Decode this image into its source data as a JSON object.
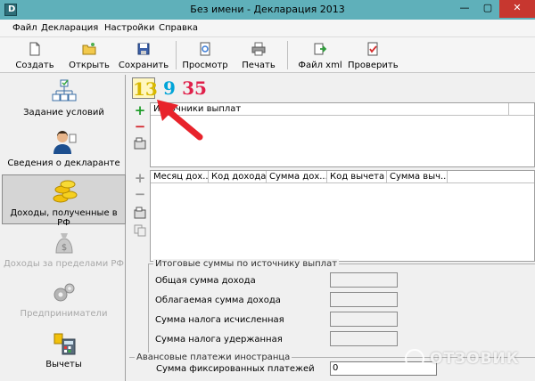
{
  "window": {
    "title": "Без имени - Декларация 2013",
    "min": "—",
    "max": "▢",
    "close": "✕"
  },
  "menu": [
    "Файл",
    "Декларация",
    "Настройки",
    "Справка"
  ],
  "toolbar": {
    "create": "Создать",
    "open": "Открыть",
    "save": "Сохранить",
    "preview": "Просмотр",
    "print": "Печать",
    "xml": "Файл xml",
    "check": "Проверить"
  },
  "sidebar": [
    {
      "label": "Задание условий",
      "icon": "tree-diagram-icon"
    },
    {
      "label": "Сведения о декларанте",
      "icon": "person-icon"
    },
    {
      "label": "Доходы, полученные в РФ",
      "icon": "coins-icon",
      "active": true
    },
    {
      "label": "Доходы за пределами РФ",
      "icon": "money-bag-icon",
      "dim": true
    },
    {
      "label": "Предприниматели",
      "icon": "gears-icon",
      "dim": true
    },
    {
      "label": "Вычеты",
      "icon": "calculator-icon"
    }
  ],
  "tax_tabs": [
    "13",
    "9",
    "35"
  ],
  "sources_grid": {
    "header": "Источники выплат"
  },
  "income_grid": {
    "headers": [
      "Месяц дох...",
      "Код дохода",
      "Сумма дох...",
      "Код вычета",
      "Сумма выч..."
    ]
  },
  "totals": {
    "title": "Итоговые суммы по источнику выплат",
    "rows": [
      "Общая сумма дохода",
      "Облагаемая сумма дохода",
      "Сумма налога исчисленная",
      "Сумма налога удержанная"
    ]
  },
  "advance": {
    "title": "Авансовые платежи иностранца",
    "label": "Сумма фиксированных платежей",
    "value": "0"
  },
  "watermark": {
    "text": "ОТЗОВИК"
  },
  "colors": {
    "titlebar": "#5fb0ba",
    "close": "#c7372f",
    "arrow": "#e8232b"
  }
}
